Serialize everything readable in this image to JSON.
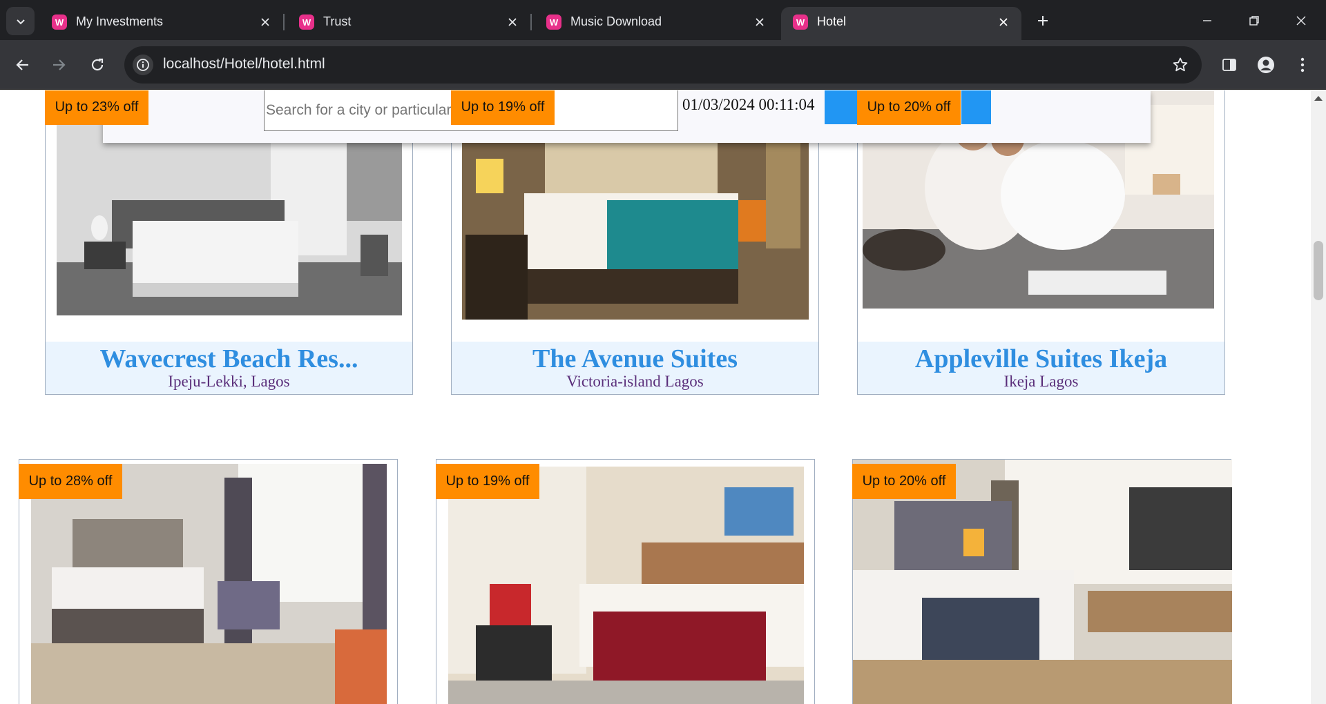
{
  "browser": {
    "tabs": [
      {
        "title": "My Investments",
        "active": false
      },
      {
        "title": "Trust",
        "active": false
      },
      {
        "title": "Music Download",
        "active": false
      },
      {
        "title": "Hotel",
        "active": true
      }
    ],
    "url": "localhost/Hotel/hotel.html",
    "icons": {
      "tab_search": "chevron-down-icon",
      "new_tab": "plus-icon",
      "back": "arrow-left-icon",
      "forward": "arrow-right-icon",
      "reload": "reload-icon",
      "site_info": "info-icon",
      "bookmark": "star-icon",
      "side_panel": "side-panel-icon",
      "profile": "profile-icon",
      "menu": "kebab-menu-icon"
    },
    "colors": {
      "chrome_dark": "#202124",
      "chrome_toolbar": "#35363a",
      "favicon": "#e8308a"
    }
  },
  "header": {
    "search_placeholder": "Search for a city or particular hotel",
    "datetime": "01/03/2024 00:11:04",
    "button_color": "#2196f3"
  },
  "hotels_row1": [
    {
      "discount": "Up to 23% off",
      "name": "Wavecrest Beach Res...",
      "location": "Ipeju-Lekki, Lagos"
    },
    {
      "discount": "Up to 19% off",
      "name": "The Avenue Suites",
      "location": "Victoria-island Lagos"
    },
    {
      "discount": "Up to 20% off",
      "name": "Appleville Suites Ikeja",
      "location": "Ikeja Lagos"
    }
  ],
  "hotels_row2": [
    {
      "discount": "Up to 28% off"
    },
    {
      "discount": "Up to 19% off"
    },
    {
      "discount": "Up to 20% off"
    }
  ],
  "theme": {
    "badge_color": "#ff8c00",
    "name_color": "#2f8ee0",
    "location_color": "#5a2e7a",
    "caption_bg": "#eaf4fe"
  }
}
